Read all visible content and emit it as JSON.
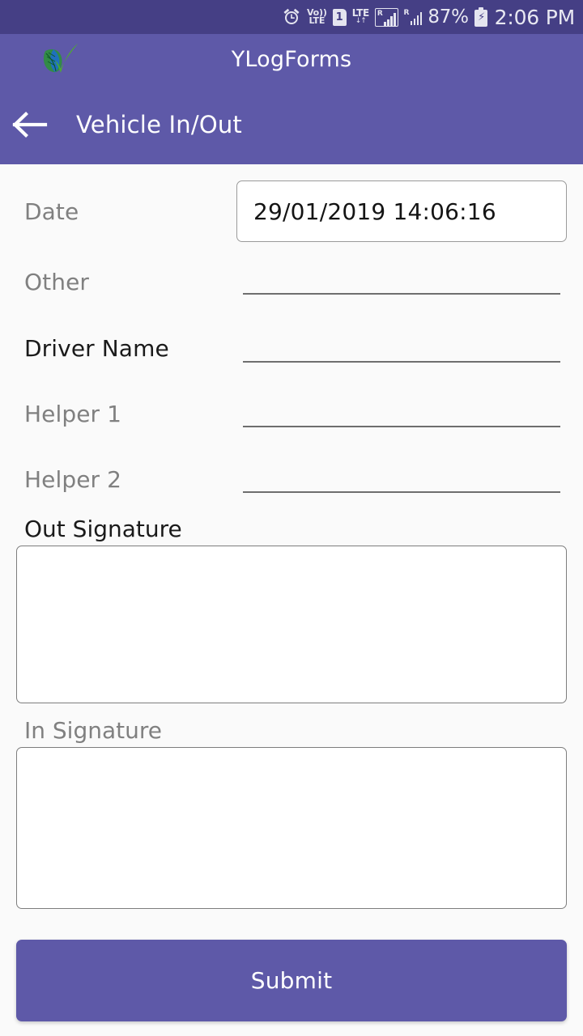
{
  "status_bar": {
    "alarm_icon": "alarm-clock-icon",
    "volte_line1": "Vo))",
    "volte_line2": "LTE",
    "sim_number": "1",
    "lte_label": "LTE",
    "lte_arrows": "↓↑",
    "roaming_label_1": "R",
    "roaming_label_2": "R",
    "battery_percent": "87%",
    "battery_icon": "battery-charging-icon",
    "time": "2:06 PM"
  },
  "app_bar": {
    "logo": "leaf-check-logo",
    "title": "YLogForms"
  },
  "sub_bar": {
    "back_icon": "back-arrow-icon",
    "page_title": "Vehicle In/Out"
  },
  "form": {
    "fields": [
      {
        "label": "Date",
        "type": "boxed",
        "value": "29/01/2019 14:06:16",
        "placeholder": "",
        "required": false
      },
      {
        "label": "Other",
        "type": "underline",
        "value": "",
        "placeholder": "",
        "required": false
      },
      {
        "label": "Driver Name",
        "type": "underline",
        "value": "",
        "placeholder": "",
        "required": true
      },
      {
        "label": "Helper 1",
        "type": "underline",
        "value": "",
        "placeholder": "",
        "required": false
      },
      {
        "label": "Helper 2",
        "type": "underline",
        "value": "",
        "placeholder": "",
        "required": false
      }
    ],
    "signatures": [
      {
        "label": "Out Signature",
        "required": true,
        "value": ""
      },
      {
        "label": "In Signature",
        "required": false,
        "value": ""
      }
    ],
    "submit_label": "Submit"
  },
  "colors": {
    "status_bar": "#453f85",
    "app_bar": "#5e59a8",
    "accent": "#5e59a8",
    "content_bg": "#fafafa",
    "label_optional": "#808080",
    "label_required": "#1a1a1a",
    "field_border": "#7d7d7d"
  }
}
